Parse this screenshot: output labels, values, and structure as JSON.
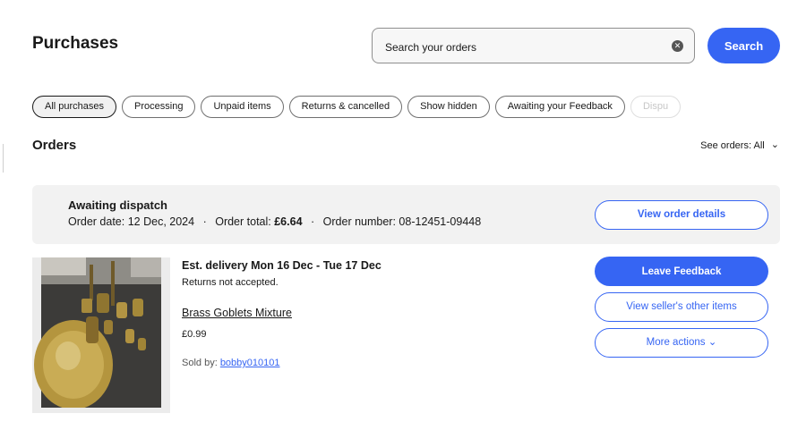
{
  "header": {
    "title": "Purchases",
    "search_placeholder": "Search your orders",
    "clear_glyph": "✕",
    "search_label": "Search"
  },
  "filters": [
    "All purchases",
    "Processing",
    "Unpaid items",
    "Returns & cancelled",
    "Show hidden",
    "Awaiting your Feedback",
    "Dispu"
  ],
  "orders": {
    "heading": "Orders",
    "see_orders_label": "See orders:",
    "see_orders_value": "All",
    "chevron_glyph": "⌄"
  },
  "order": {
    "status": "Awaiting dispatch",
    "order_date_label": "Order date:",
    "order_date": "12 Dec, 2024",
    "order_total_label": "Order total:",
    "order_total": "£6.64",
    "order_number_label": "Order number:",
    "order_number": "08-12451-09448",
    "separator": "·",
    "view_details_label": "View order details"
  },
  "item": {
    "est_delivery": "Est. delivery Mon 16 Dec - Tue 17 Dec",
    "returns": "Returns not accepted.",
    "title": "Brass Goblets Mixture",
    "price": "£0.99",
    "sold_by_label": "Sold by:",
    "seller": "bobby010101",
    "image_icon": "item-photo"
  },
  "actions": {
    "leave_feedback": "Leave Feedback",
    "view_seller_items": "View seller's other items",
    "more_actions": "More actions",
    "more_chevron": "⌄"
  },
  "colors": {
    "accent": "#3665f3",
    "panel": "#f2f2f2",
    "text": "#191919"
  }
}
